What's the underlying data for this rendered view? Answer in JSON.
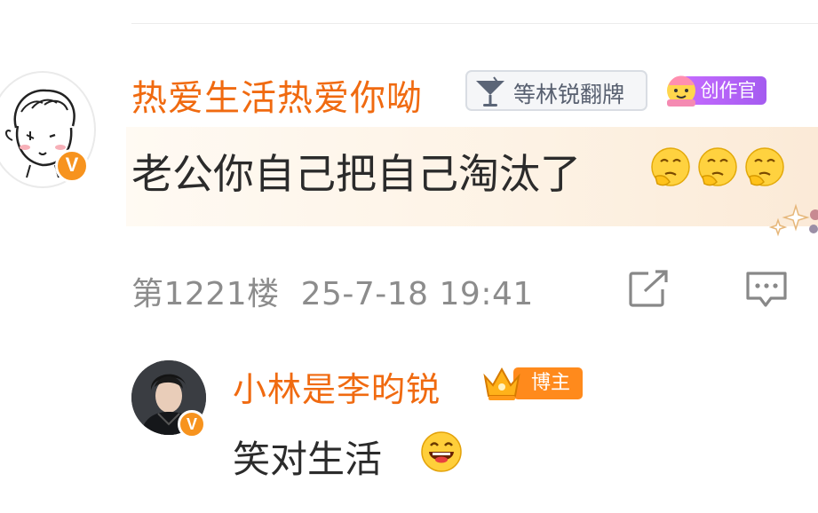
{
  "comment": {
    "user_name": "热爱生活热爱你呦",
    "fan_badge_label": "等林锐翻牌",
    "creator_badge_label": "创作官",
    "text": "老公你自己把自己淘汰了",
    "emojis": [
      "thinking-emoji",
      "thinking-emoji",
      "thinking-emoji"
    ],
    "floor": "第1221楼",
    "timestamp": "25-7-18 19:41",
    "verified_mark": "V"
  },
  "reply": {
    "user_name": "小林是李昀锐",
    "role_badge_label": "博主",
    "text": "笑对生活",
    "emoji": "laughing-emoji",
    "verified_mark": "V"
  },
  "colors": {
    "username": "#f06a10",
    "verified": "#f7931e",
    "creator_badge": "#b063f5",
    "blogger_badge": "#ff8a1c",
    "meta_text": "#8c8c8c"
  }
}
